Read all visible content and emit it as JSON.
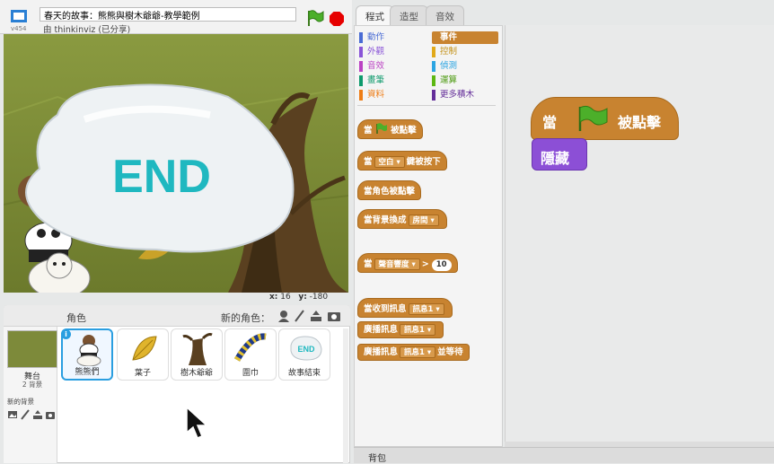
{
  "header": {
    "version": "v454",
    "project_title": "春天的故事：熊熊與樹木爺爺-教學範例",
    "author": "由 thinkinviz (已分享)"
  },
  "stage": {
    "end_text": "END",
    "coords": {
      "x_label": "x:",
      "x_value": "16",
      "y_label": "y:",
      "y_value": "-180"
    }
  },
  "sprite_pane": {
    "sprites_label": "角色",
    "new_sprite_label": "新的角色：",
    "stage_label": "舞台",
    "backdrop_count": "2 背景",
    "new_backdrop_label": "新的背景",
    "sprites": [
      {
        "name": "熊熊們",
        "selected": true
      },
      {
        "name": "葉子",
        "selected": false
      },
      {
        "name": "樹木爺爺",
        "selected": false
      },
      {
        "name": "圍巾",
        "selected": false
      },
      {
        "name": "故事結束",
        "selected": false
      }
    ]
  },
  "tabs": [
    "程式",
    "造型",
    "音效"
  ],
  "categories": {
    "left": [
      {
        "label": "動作",
        "color": "#4a6cd4"
      },
      {
        "label": "外觀",
        "color": "#8a55d7"
      },
      {
        "label": "音效",
        "color": "#bb42c3"
      },
      {
        "label": "畫筆",
        "color": "#0e9a6c"
      },
      {
        "label": "資料",
        "color": "#ee7d16"
      }
    ],
    "right": [
      {
        "label": "事件",
        "color": "#c88330",
        "selected": true
      },
      {
        "label": "控制",
        "color": "#e1a91a"
      },
      {
        "label": "偵測",
        "color": "#2ca5e2"
      },
      {
        "label": "運算",
        "color": "#5cb712"
      },
      {
        "label": "更多積木",
        "color": "#632d99"
      }
    ]
  },
  "blocks": {
    "when_flag_pre": "當",
    "when_flag_post": "被點擊",
    "when_key_pre": "當",
    "when_key_dd": "空白",
    "when_key_post": "鍵被按下",
    "when_sprite_clicked": "當角色被點擊",
    "when_backdrop_pre": "當背景換成",
    "when_backdrop_dd": "房間",
    "when_sensor_pre": "當",
    "when_sensor_dd": "聲音響度",
    "when_sensor_op": ">",
    "when_sensor_value": "10",
    "when_receive_pre": "當收到訊息",
    "when_receive_dd": "訊息1",
    "broadcast_pre": "廣播訊息",
    "broadcast_dd": "訊息1",
    "broadcast_wait_pre": "廣播訊息",
    "broadcast_wait_dd": "訊息1",
    "broadcast_wait_post": "並等待"
  },
  "script": {
    "hat_pre": "當",
    "hat_post": "被點擊",
    "hide": "隱藏"
  },
  "backpack": {
    "label": "背包"
  },
  "colors": {
    "events": "#c88330",
    "looks": "#8c4fd6",
    "selected_blue": "#2a9ee0"
  }
}
